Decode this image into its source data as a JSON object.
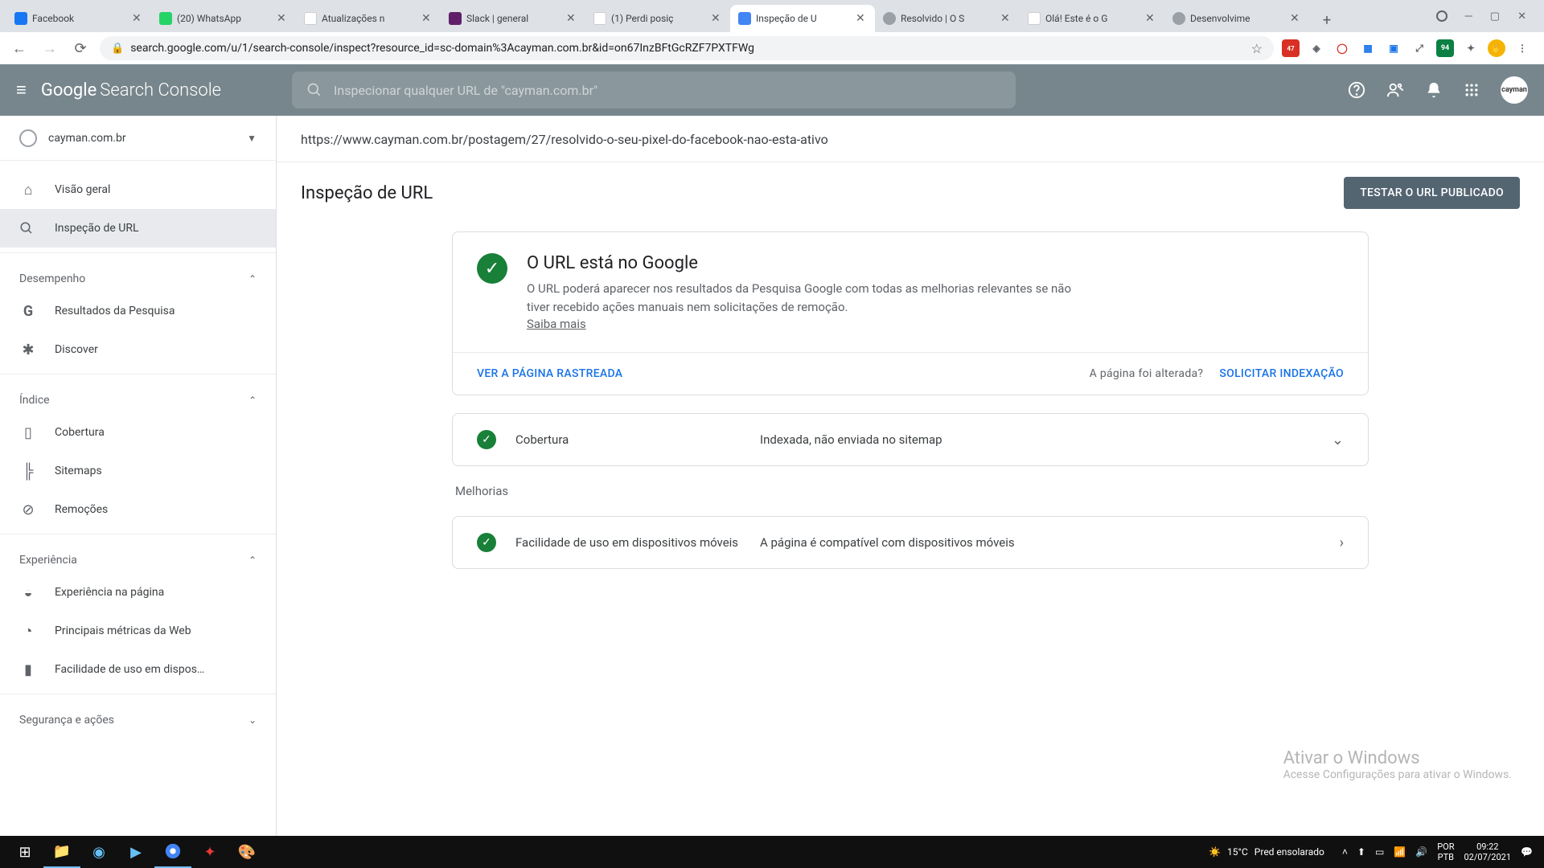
{
  "browser": {
    "tabs": [
      {
        "title": "Facebook",
        "favicon": "#1877f2"
      },
      {
        "title": "(20) WhatsApp",
        "favicon": "#25d366"
      },
      {
        "title": "Atualizações n",
        "favicon": "#34a853"
      },
      {
        "title": "Slack | general",
        "favicon": "#611f69"
      },
      {
        "title": "(1) Perdi posiç",
        "favicon": "#202124"
      },
      {
        "title": "Inspeção de U",
        "favicon": "#4285f4",
        "active": true
      },
      {
        "title": "Resolvido | O S",
        "favicon": "#5f6368"
      },
      {
        "title": "Olá! Este é o G",
        "favicon": "#4285f4"
      },
      {
        "title": "Desenvolvime",
        "favicon": "#5f6368"
      }
    ],
    "url": "search.google.com/u/1/search-console/inspect?resource_id=sc-domain%3Acayman.com.br&id=on67InzBFtGcRZF7PXTFWg"
  },
  "appbar": {
    "logo_g": "Google",
    "logo_sc": "Search Console",
    "search_placeholder": "Inspecionar qualquer URL de \"cayman.com.br\""
  },
  "sidebar": {
    "property": "cayman.com.br",
    "items": {
      "overview": "Visão geral",
      "inspect": "Inspeção de URL"
    },
    "section_perf": "Desempenho",
    "perf": {
      "search": "Resultados da Pesquisa",
      "discover": "Discover"
    },
    "section_index": "Índice",
    "index": {
      "coverage": "Cobertura",
      "sitemaps": "Sitemaps",
      "removals": "Remoções"
    },
    "section_exp": "Experiência",
    "exp": {
      "page": "Experiência na página",
      "cwv": "Principais métricas da Web",
      "mobile": "Facilidade de uso em dispos…"
    },
    "section_sec": "Segurança e ações"
  },
  "main": {
    "inspected_url": "https://www.cayman.com.br/postagem/27/resolvido-o-seu-pixel-do-facebook-nao-esta-ativo",
    "title": "Inspeção de URL",
    "test_btn": "TESTAR O URL PUBLICADO",
    "status_title": "O URL está no Google",
    "status_desc": "O URL poderá aparecer nos resultados da Pesquisa Google com todas as melhorias relevantes se não tiver recebido ações manuais nem solicitações de remoção.",
    "learn_more": "Saiba mais",
    "view_crawled": "VER A PÁGINA RASTREADA",
    "page_changed": "A página foi alterada?",
    "request_index": "SOLICITAR INDEXAÇÃO",
    "coverage_label": "Cobertura",
    "coverage_value": "Indexada, não enviada no sitemap",
    "enh_section": "Melhorias",
    "mobile_label": "Facilidade de uso em dispositivos móveis",
    "mobile_value": "A página é compatível com dispositivos móveis"
  },
  "watermark": {
    "l1": "Ativar o Windows",
    "l2": "Acesse Configurações para ativar o Windows."
  },
  "taskbar": {
    "weather_temp": "15°C",
    "weather_txt": "Pred ensolarado",
    "lang1": "POR",
    "lang2": "PTB",
    "time": "09:22",
    "date": "02/07/2021"
  }
}
